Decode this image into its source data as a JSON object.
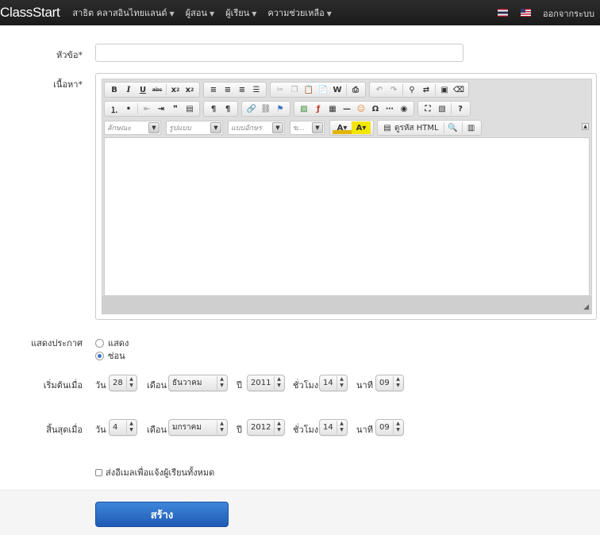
{
  "navbar": {
    "brand": "ClassStart",
    "items": [
      {
        "label": "สาธิต คลาสอินไทยแลนด์"
      },
      {
        "label": "ผู้สอน"
      },
      {
        "label": "ผู้เรียน"
      },
      {
        "label": "ความช่วยเหลือ"
      }
    ],
    "logout": "ออกจากระบบ"
  },
  "form": {
    "title_label": "หัวข้อ*",
    "title_value": "",
    "content_label": "เนื้อหา*",
    "editor": {
      "font_combo": "ลักษณะ",
      "format_combo": "รูปแบบ",
      "fontname_combo": "แบบอักษร",
      "size_combo": "ข...",
      "source_label": "ดูรหัส HTML",
      "content": ""
    },
    "display_label": "แสดงประกาศ",
    "display_options": [
      {
        "label": "แสดง",
        "selected": false
      },
      {
        "label": "ซ่อน",
        "selected": true
      }
    ],
    "start": {
      "label": "เริ่มต้นเมื่อ",
      "day_label": "วัน",
      "day": "28",
      "month_label": "เดือน",
      "month": "ธันวาคม",
      "year_label": "ปี",
      "year": "2011",
      "hour_label": "ชั่วโมง",
      "hour": "14",
      "minute_label": "นาที",
      "minute": "09"
    },
    "end": {
      "label": "สิ้นสุดเมื่อ",
      "day_label": "วัน",
      "day": "4",
      "month_label": "เดือน",
      "month": "มกราคม",
      "year_label": "ปี",
      "year": "2012",
      "hour_label": "ชั่วโมง",
      "hour": "14",
      "minute_label": "นาที",
      "minute": "09"
    },
    "notify_label": "ส่งอีเมลเพื่อแจ้งผู้เรียนทั้งหมด",
    "notify_checked": false,
    "submit_label": "สร้าง"
  },
  "colors": {
    "navbar": "#1b1b1b",
    "primary_button": "#2a6cc8",
    "radio_selected": "#3b74c7"
  }
}
